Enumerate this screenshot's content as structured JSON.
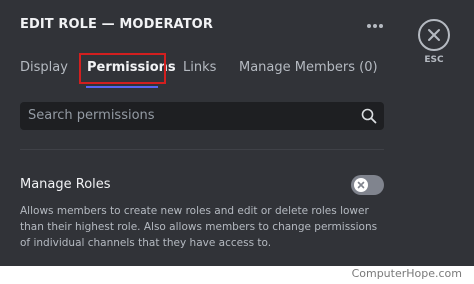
{
  "header": {
    "title": "EDIT ROLE — MODERATOR",
    "more_icon": "more-horizontal-icon"
  },
  "esc": {
    "icon": "close-icon",
    "label": "ESC"
  },
  "tabs": [
    {
      "label": "Display",
      "active": false
    },
    {
      "label": "Permissions",
      "active": true
    },
    {
      "label": "Links",
      "active": false
    },
    {
      "label": "Manage Members (0)",
      "active": false
    }
  ],
  "search": {
    "placeholder": "Search permissions",
    "value": "",
    "icon": "search-icon"
  },
  "permission": {
    "title": "Manage Roles",
    "description": "Allows members to create new roles and edit or delete roles lower than their highest role. Also allows members to change permissions of individual channels that they have access to.",
    "enabled": false
  },
  "watermark": "ComputerHope.com",
  "colors": {
    "background": "#313338",
    "active_tab_underline": "#5865f2",
    "highlight_box": "#d21f1f",
    "toggle_off": "#80848e"
  }
}
